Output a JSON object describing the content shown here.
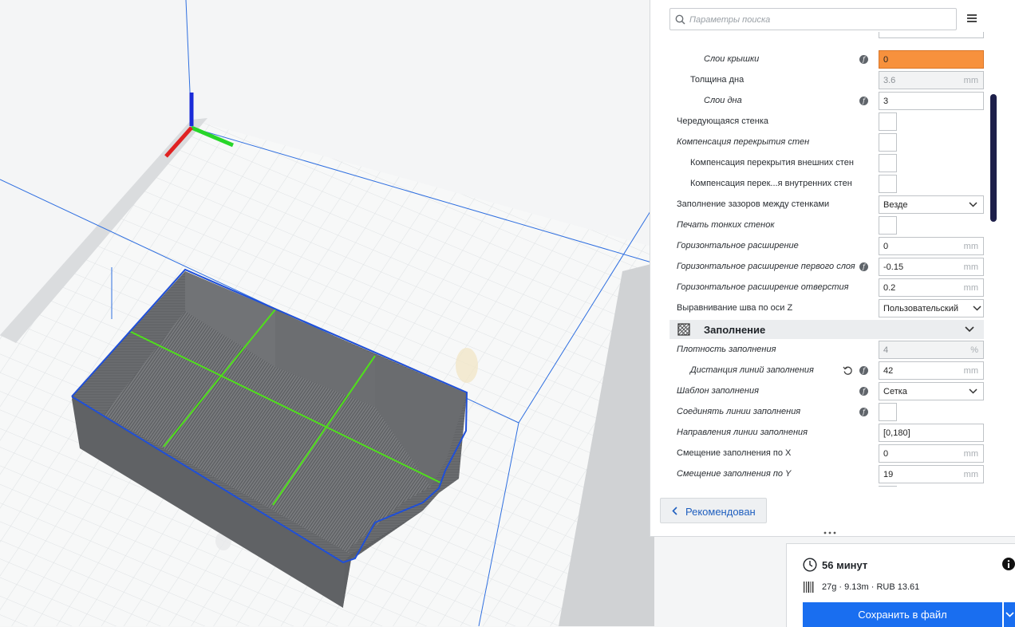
{
  "search": {
    "placeholder": "Параметры поиска"
  },
  "settings": [
    {
      "label": "Слои крышки",
      "italic": true,
      "fx": true,
      "value": "0",
      "state": "error"
    },
    {
      "label": "Толщина дна",
      "value": "3.6",
      "unit": "mm",
      "state": "disabled"
    },
    {
      "label": "Слои дна",
      "italic": true,
      "fx": true,
      "value": "3"
    },
    {
      "label": "Чередующаяся стенка",
      "type": "checkbox"
    },
    {
      "label": "Компенсация перекрытия стен",
      "italic": true,
      "type": "checkbox"
    },
    {
      "label": "Компенсация перекрытия внешних стен",
      "type": "checkbox"
    },
    {
      "label": "Компенсация перек...я внутренних стен",
      "type": "checkbox"
    },
    {
      "label": "Заполнение зазоров между стенками",
      "type": "select",
      "value": "Везде"
    },
    {
      "label": "Печать тонких стенок",
      "italic": true,
      "type": "checkbox"
    },
    {
      "label": "Горизонтальное расширение",
      "italic": true,
      "value": "0",
      "unit": "mm"
    },
    {
      "label": "Горизонтальное расширение первого слоя",
      "italic": true,
      "fx": true,
      "value": "-0.15",
      "unit": "mm"
    },
    {
      "label": "Горизонтальное расширение отверстия",
      "italic": true,
      "value": "0.2",
      "unit": "mm"
    },
    {
      "label": "Выравнивание шва по оси Z",
      "type": "select",
      "value": "Пользовательский"
    },
    {
      "label": "Плотность заполнения",
      "italic": true,
      "value": "4",
      "unit": "%",
      "state": "disabled"
    },
    {
      "label": "Дистанция линий заполнения",
      "italic": true,
      "fx": true,
      "reset": true,
      "value": "42",
      "unit": "mm"
    },
    {
      "label": "Шаблон заполнения",
      "italic": true,
      "fx": true,
      "type": "select",
      "value": "Сетка"
    },
    {
      "label": "Соединять линии заполнения",
      "italic": true,
      "fx": true,
      "type": "checkbox"
    },
    {
      "label": "Направления линии заполнения",
      "italic": true,
      "value": "[0,180]"
    },
    {
      "label": "Смещение заполнения по X",
      "value": "0",
      "unit": "mm"
    },
    {
      "label": "Смещение заполнения по Y",
      "italic": true,
      "value": "19",
      "unit": "mm"
    }
  ],
  "category": {
    "title": "Заполнение"
  },
  "recommended_label": "Рекомендован",
  "estimate": {
    "time": "56 минут",
    "material": "27g · 9.13m · RUB 13.61"
  },
  "save_label": "Сохранить в файл",
  "colors": {
    "accent": "#196ef0",
    "error": "#f7913d",
    "scrollbar": "#1d1f4a",
    "line_green": "#4fe01a",
    "line_blue": "#1f4fd8"
  }
}
